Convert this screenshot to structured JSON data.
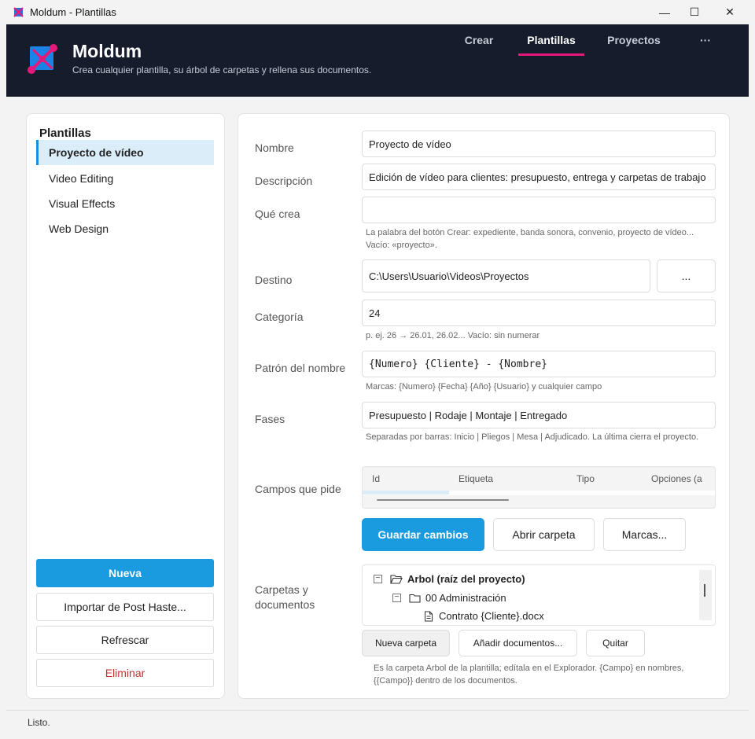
{
  "window": {
    "title": "Moldum - Plantillas",
    "minimize": "—",
    "maximize": "☐",
    "close": "✕"
  },
  "header": {
    "brand": "Moldum",
    "tagline": "Crea cualquier plantilla, su árbol de carpetas y rellena sus documentos.",
    "tabs": [
      {
        "label": "Crear"
      },
      {
        "label": "Plantillas"
      },
      {
        "label": "Proyectos"
      },
      {
        "label": "···"
      }
    ],
    "active_tab": "Plantillas",
    "accent": "#e6197a"
  },
  "sidebar": {
    "heading": "Plantillas",
    "items": [
      {
        "label": "Proyecto de vídeo"
      },
      {
        "label": "Video Editing"
      },
      {
        "label": "Visual Effects"
      },
      {
        "label": "Web Design"
      }
    ],
    "selected": "Proyecto de vídeo",
    "buttons": {
      "new": "Nueva",
      "import": "Importar de Post Haste...",
      "refresh": "Refrescar",
      "delete": "Eliminar"
    }
  },
  "form": {
    "name": {
      "label": "Nombre",
      "value": "Proyecto de vídeo"
    },
    "description": {
      "label": "Descripción",
      "value": "Edición de vídeo para clientes: presupuesto, entrega y carpetas de trabajo"
    },
    "creates": {
      "label": "Qué crea",
      "value": "",
      "hint": "La palabra del botón Crear: expediente, banda sonora, convenio, proyecto de vídeo... Vacío: «proyecto»."
    },
    "destination": {
      "label": "Destino",
      "value": "C:\\Users\\Usuario\\Videos\\Proyectos",
      "browse": "..."
    },
    "category": {
      "label": "Categoría",
      "value": "24",
      "hint": "p. ej. 26 → 26.01, 26.02... Vacío: sin numerar"
    },
    "name_pattern": {
      "label": "Patrón del nombre",
      "value": "{Numero} {Cliente} - {Nombre}",
      "hint": "Marcas: {Numero} {Fecha} {Año} {Usuario} y cualquier campo"
    },
    "phases": {
      "label": "Fases",
      "value": "Presupuesto | Rodaje | Montaje | Entregado",
      "hint": "Separadas por barras: Inicio | Pliegos | Mesa | Adjudicado. La última cierra el proyecto."
    },
    "fields": {
      "label": "Campos que pide",
      "columns": [
        "Id",
        "Etiqueta",
        "Tipo",
        "Opciones (a"
      ]
    },
    "actions": {
      "save": "Guardar cambios",
      "open_folder": "Abrir carpeta",
      "marks": "Marcas..."
    },
    "folders": {
      "label": "Carpetas y documentos",
      "tree": [
        {
          "label": "Arbol (raíz del proyecto)",
          "level": 0
        },
        {
          "label": "00 Administración",
          "level": 1
        },
        {
          "label": "Contrato {Cliente}.docx",
          "level": 2
        }
      ],
      "buttons": {
        "new_folder": "Nueva carpeta",
        "add_docs": "Añadir documentos...",
        "remove": "Quitar"
      },
      "hint": "Es la carpeta Arbol de la plantilla; edítala en el Explorador. {Campo} en nombres, {{Campo}} dentro de los documentos."
    }
  },
  "status": "Listo."
}
